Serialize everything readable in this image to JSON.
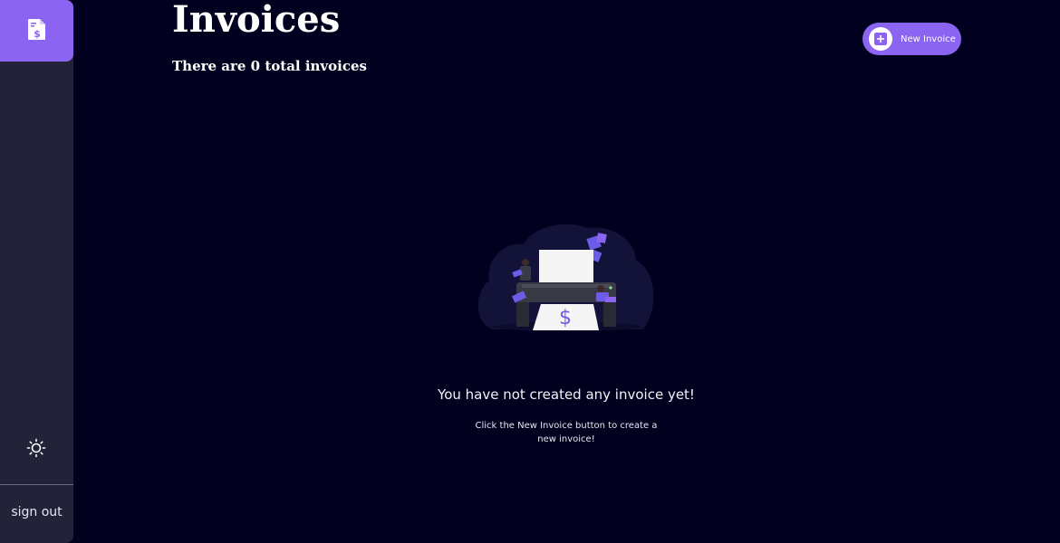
{
  "sidebar": {
    "logo_icon": "invoice-dollar-icon",
    "theme_icon": "sun-icon",
    "signout_label": "sign out"
  },
  "header": {
    "title": "Invoices",
    "subtitle": "There are 0 total invoices",
    "new_button_label": "New Invoice",
    "new_button_icon": "plus-icon"
  },
  "empty_state": {
    "illustration": "printer-with-people-illustration",
    "title": "You have not created any invoice yet!",
    "description": "Click the New Invoice button to create a new invoice!"
  },
  "colors": {
    "background": "#01011f",
    "sidebar": "#222338",
    "accent": "#8b64f2"
  }
}
